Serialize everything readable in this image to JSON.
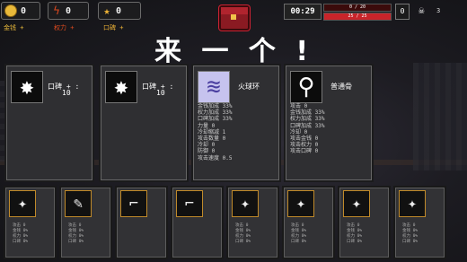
{
  "resources": [
    {
      "icon": "coin-icon",
      "value": "0",
      "label": "金钱 +",
      "label_color": "#e9b93a"
    },
    {
      "icon": "bolt-icon",
      "value": "0",
      "label": "权力 +",
      "label_color": "#e04a1e"
    },
    {
      "icon": "star-icon",
      "value": "0",
      "label": "口碑 +",
      "label_color": "#f0b436"
    }
  ],
  "hud": {
    "timer": "00:29",
    "xp_bar": "0 / 20",
    "xp_progress": 0.0,
    "hp_bar": "25 / 25",
    "hp_progress": 1.0,
    "level": "0",
    "kills": "3"
  },
  "title": "来 一 个 !",
  "cards": [
    {
      "icon": "star-badge-icon",
      "name": "口碑 + :",
      "amount": "10",
      "stats": []
    },
    {
      "icon": "star-badge-icon",
      "name": "口碑 + :",
      "amount": "10",
      "stats": []
    },
    {
      "icon": "fire-ring-icon",
      "name": "火球环",
      "amount": "",
      "stats": [
        "金钱加成 33%",
        "权力加成 33%",
        "口碑加成 33%",
        "力量 0",
        "冷却缩减 1",
        "攻击数量 0",
        "冷却 0",
        "防御 0",
        "攻击速度 0.5"
      ]
    },
    {
      "icon": "bone-icon",
      "name": "普通骨",
      "amount": "",
      "stats": [
        "攻击 0",
        "金钱加成 33%",
        "权力加成 33%",
        "口碑加成 33%",
        "冷却 0",
        "攻击金钱 0",
        "攻击权力 0",
        "攻击口碑 0"
      ]
    }
  ],
  "slots": [
    {
      "icon": "weapon-icon"
    },
    {
      "icon": "staff-icon"
    },
    {
      "icon": "boot-icon"
    },
    {
      "icon": "boot-icon"
    },
    {
      "icon": "weapon-icon"
    },
    {
      "icon": "weapon-icon"
    },
    {
      "icon": "weapon-icon"
    },
    {
      "icon": "weapon-icon"
    }
  ],
  "slot_stats": [
    "攻击 0",
    "金钱 0%",
    "权力 0%",
    "口碑 0%"
  ]
}
